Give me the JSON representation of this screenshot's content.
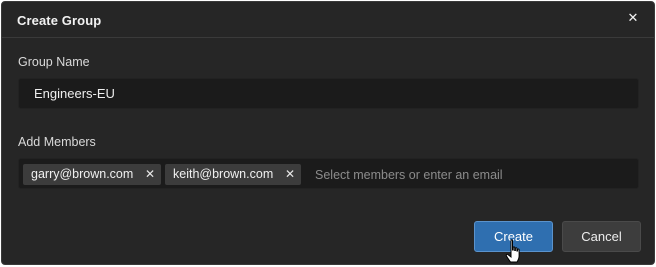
{
  "dialog": {
    "title": "Create Group",
    "close_icon": "close-icon",
    "close_glyph": "✕"
  },
  "group_name": {
    "label": "Group Name",
    "value": "Engineers-EU"
  },
  "members": {
    "label": "Add Members",
    "chips": [
      {
        "email": "garry@brown.com",
        "remove_glyph": "✕"
      },
      {
        "email": "keith@brown.com",
        "remove_glyph": "✕"
      }
    ],
    "placeholder": "Select members or enter an email"
  },
  "buttons": {
    "create_label": "Create",
    "cancel_label": "Cancel"
  },
  "colors": {
    "dialog_bg": "#262626",
    "input_bg": "#1b1b1b",
    "chip_bg": "#3c3c3c",
    "primary": "#2f6fb0",
    "secondary": "#3d3d3d"
  },
  "cursor_icon": "hand-pointer-icon"
}
